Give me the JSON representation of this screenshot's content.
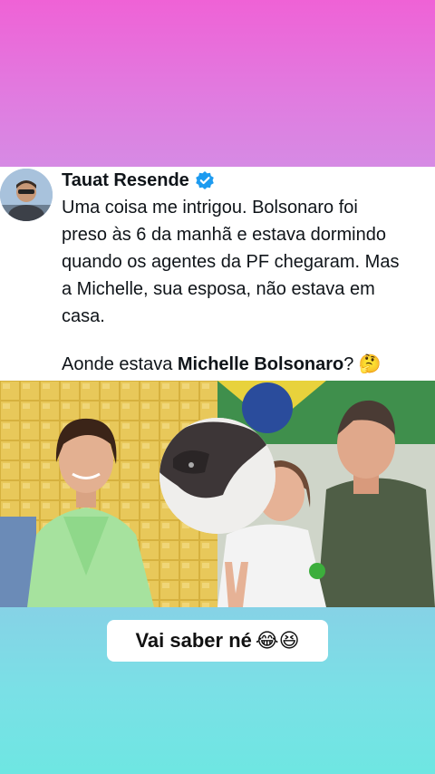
{
  "tweet": {
    "author_name": "Tauat Resende",
    "lines": [
      "Uma coisa me intrigou. Bolsonaro foi",
      "preso às 6 da manhã e estava dormindo",
      "quando os agentes da PF chegaram. Mas",
      "a Michelle, sua esposa, não estava em",
      "casa."
    ],
    "question_prefix": "Aonde estava ",
    "question_bold": "Michelle Bolsonaro",
    "question_suffix": "? 🤔"
  },
  "caption": {
    "text": "Vai saber né",
    "emojis": "😂😆"
  },
  "colors": {
    "top_gradient": "#ef62d6",
    "bottom_gradient": "#7ae0e6",
    "verified_blue": "#1d9bf0"
  },
  "icons": {
    "verified": "verified-badge-icon"
  }
}
